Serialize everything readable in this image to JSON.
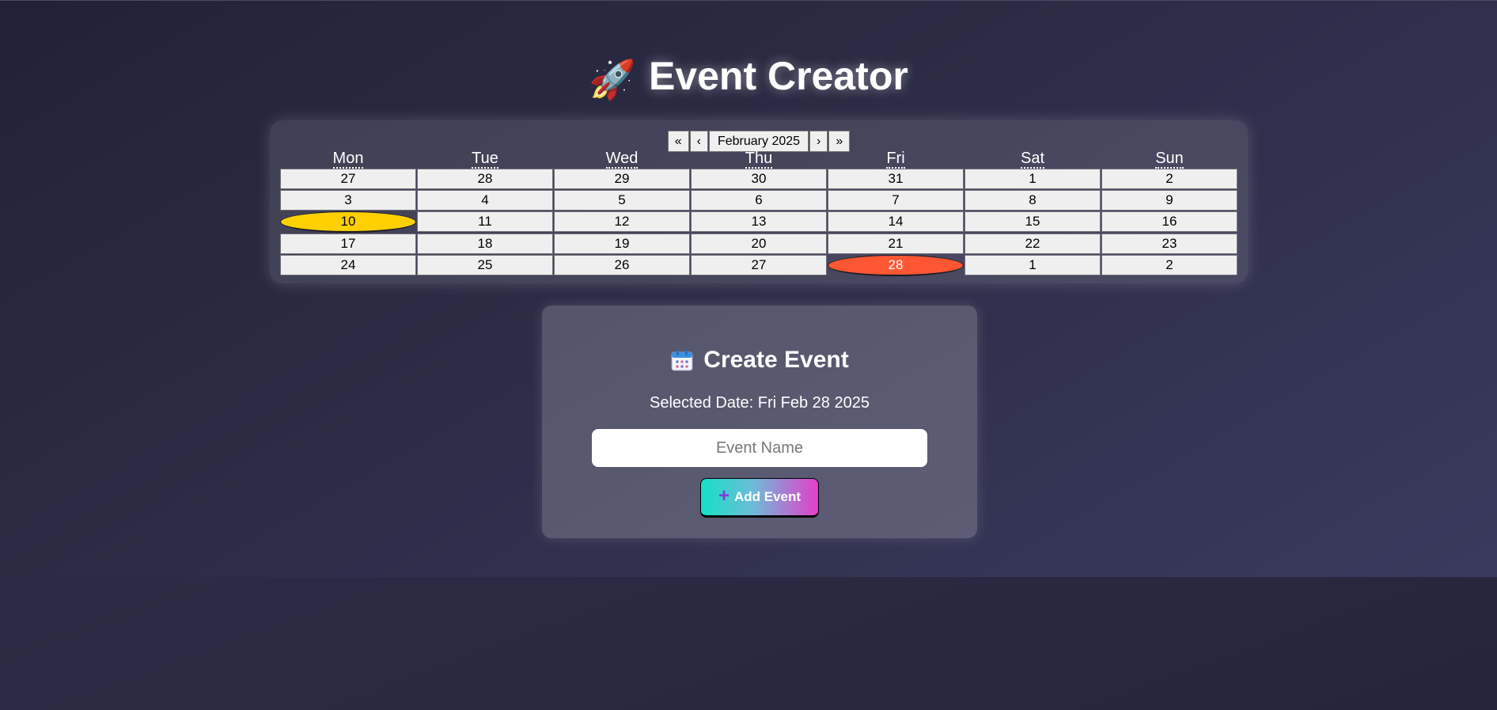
{
  "app": {
    "title": "Event Creator",
    "title_icon": "rocket-icon"
  },
  "calendar": {
    "nav": {
      "prev_year": "«",
      "prev_month": "‹",
      "label": "February 2025",
      "next_month": "›",
      "next_year": "»"
    },
    "weekdays": [
      "Mon",
      "Tue",
      "Wed",
      "Thu",
      "Fri",
      "Sat",
      "Sun"
    ],
    "weeks": [
      [
        "27",
        "28",
        "29",
        "30",
        "31",
        "1",
        "2"
      ],
      [
        "3",
        "4",
        "5",
        "6",
        "7",
        "8",
        "9"
      ],
      [
        "10",
        "11",
        "12",
        "13",
        "14",
        "15",
        "16"
      ],
      [
        "17",
        "18",
        "19",
        "20",
        "21",
        "22",
        "23"
      ],
      [
        "24",
        "25",
        "26",
        "27",
        "28",
        "1",
        "2"
      ]
    ],
    "today": {
      "week": 2,
      "day": 0
    },
    "selected": {
      "week": 4,
      "day": 4
    },
    "colors": {
      "today": "#ffd000",
      "selected": "#ff5733"
    }
  },
  "form": {
    "heading": "Create Event",
    "heading_icon": "calendar-icon",
    "selected_date": "Selected Date: Fri Feb 28 2025",
    "event_name_placeholder": "Event Name",
    "event_name_value": "",
    "add_button_label": "Add Event",
    "add_button_icon": "plus-icon"
  }
}
